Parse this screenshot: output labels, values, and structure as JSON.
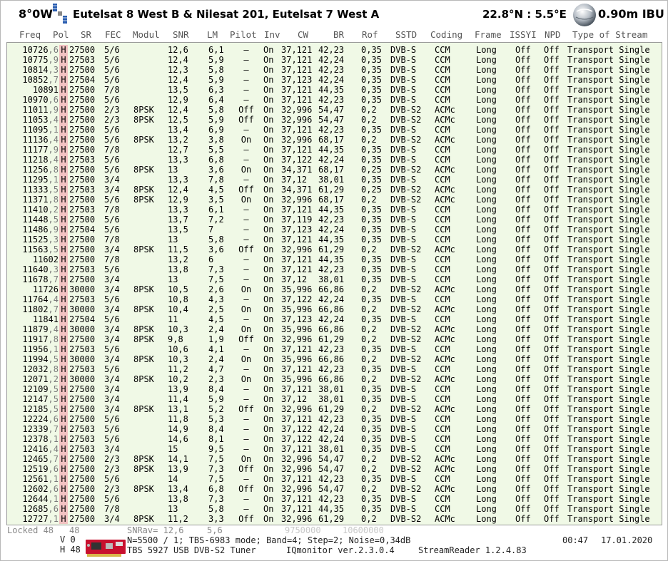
{
  "header": {
    "position": "8°0W",
    "title": "Eutelsat 8 West B & Nilesat 201, Eutelsat 7 West A",
    "coords": "22.8°N : 5.5°E",
    "dish": "0.90m IBU"
  },
  "columns": [
    "Freq",
    "Pol",
    "SR",
    "FEC",
    "Modul",
    "SNR",
    "LM",
    "Pilot",
    "Inv",
    "CW",
    "BR",
    "Rof",
    "SSTD",
    "Coding",
    "Frame",
    "ISSYI",
    "NPD",
    "Type of Stream"
  ],
  "rows": [
    [
      "10726,6",
      "H",
      "27500",
      "5/6",
      "",
      "12,6",
      "6,1",
      "–",
      "On",
      "37,121",
      "42,23",
      "0,35",
      "DVB-S",
      "CCM",
      "Long",
      "Off",
      "Off",
      "Transport Single"
    ],
    [
      "10775,9",
      "H",
      "27503",
      "5/6",
      "",
      "12,4",
      "5,9",
      "–",
      "On",
      "37,121",
      "42,24",
      "0,35",
      "DVB-S",
      "CCM",
      "Long",
      "Off",
      "Off",
      "Transport Single"
    ],
    [
      "10814,3",
      "H",
      "27500",
      "5/6",
      "",
      "12,3",
      "5,8",
      "–",
      "On",
      "37,121",
      "42,23",
      "0,35",
      "DVB-S",
      "CCM",
      "Long",
      "Off",
      "Off",
      "Transport Single"
    ],
    [
      "10852,7",
      "H",
      "27504",
      "5/6",
      "",
      "12,4",
      "5,9",
      "–",
      "On",
      "37,123",
      "42,24",
      "0,35",
      "DVB-S",
      "CCM",
      "Long",
      "Off",
      "Off",
      "Transport Single"
    ],
    [
      "10891",
      "H",
      "27500",
      "7/8",
      "",
      "13,5",
      "6,3",
      "–",
      "On",
      "37,121",
      "44,35",
      "0,35",
      "DVB-S",
      "CCM",
      "Long",
      "Off",
      "Off",
      "Transport Single"
    ],
    [
      "10970,6",
      "H",
      "27500",
      "5/6",
      "",
      "12,9",
      "6,4",
      "–",
      "On",
      "37,121",
      "42,23",
      "0,35",
      "DVB-S",
      "CCM",
      "Long",
      "Off",
      "Off",
      "Transport Single"
    ],
    [
      "11011,9",
      "H",
      "27500",
      "2/3",
      "8PSK",
      "12,4",
      "5,8",
      "Off",
      "On",
      "32,996",
      "54,47",
      "0,2",
      "DVB-S2",
      "ACMc",
      "Long",
      "Off",
      "Off",
      "Transport Single"
    ],
    [
      "11053,4",
      "H",
      "27500",
      "2/3",
      "8PSK",
      "12,5",
      "5,9",
      "Off",
      "On",
      "32,996",
      "54,47",
      "0,2",
      "DVB-S2",
      "ACMc",
      "Long",
      "Off",
      "Off",
      "Transport Single"
    ],
    [
      "11095,1",
      "H",
      "27500",
      "5/6",
      "",
      "13,4",
      "6,9",
      "–",
      "On",
      "37,121",
      "42,23",
      "0,35",
      "DVB-S",
      "CCM",
      "Long",
      "Off",
      "Off",
      "Transport Single"
    ],
    [
      "11136,4",
      "H",
      "27500",
      "5/6",
      "8PSK",
      "13,2",
      "3,8",
      "On",
      "On",
      "32,996",
      "68,17",
      "0,2",
      "DVB-S2",
      "ACMc",
      "Long",
      "Off",
      "Off",
      "Transport Single"
    ],
    [
      "11177,9",
      "H",
      "27500",
      "7/8",
      "",
      "12,7",
      "5,5",
      "–",
      "On",
      "37,121",
      "44,35",
      "0,35",
      "DVB-S",
      "CCM",
      "Long",
      "Off",
      "Off",
      "Transport Single"
    ],
    [
      "11218,4",
      "H",
      "27503",
      "5/6",
      "",
      "13,3",
      "6,8",
      "–",
      "On",
      "37,122",
      "42,24",
      "0,35",
      "DVB-S",
      "CCM",
      "Long",
      "Off",
      "Off",
      "Transport Single"
    ],
    [
      "11256,8",
      "H",
      "27500",
      "5/6",
      "8PSK",
      "13",
      "3,6",
      "On",
      "On",
      "34,371",
      "68,17",
      "0,25",
      "DVB-S2",
      "ACMc",
      "Long",
      "Off",
      "Off",
      "Transport Single"
    ],
    [
      "11295,1",
      "H",
      "27500",
      "3/4",
      "",
      "13,3",
      "7,8",
      "–",
      "On",
      "37,12",
      "38,01",
      "0,35",
      "DVB-S",
      "CCM",
      "Long",
      "Off",
      "Off",
      "Transport Single"
    ],
    [
      "11333,5",
      "H",
      "27503",
      "3/4",
      "8PSK",
      "12,4",
      "4,5",
      "Off",
      "On",
      "34,371",
      "61,29",
      "0,25",
      "DVB-S2",
      "ACMc",
      "Long",
      "Off",
      "Off",
      "Transport Single"
    ],
    [
      "11371,8",
      "H",
      "27500",
      "5/6",
      "8PSK",
      "12,9",
      "3,5",
      "On",
      "On",
      "32,996",
      "68,17",
      "0,2",
      "DVB-S2",
      "ACMc",
      "Long",
      "Off",
      "Off",
      "Transport Single"
    ],
    [
      "11410,2",
      "H",
      "27503",
      "7/8",
      "",
      "13,3",
      "6,1",
      "–",
      "On",
      "37,121",
      "44,35",
      "0,35",
      "DVB-S",
      "CCM",
      "Long",
      "Off",
      "Off",
      "Transport Single"
    ],
    [
      "11448,5",
      "H",
      "27500",
      "5/6",
      "",
      "13,7",
      "7,2",
      "–",
      "On",
      "37,119",
      "42,23",
      "0,35",
      "DVB-S",
      "CCM",
      "Long",
      "Off",
      "Off",
      "Transport Single"
    ],
    [
      "11486,9",
      "H",
      "27504",
      "5/6",
      "",
      "13,5",
      "7",
      "–",
      "On",
      "37,123",
      "42,24",
      "0,35",
      "DVB-S",
      "CCM",
      "Long",
      "Off",
      "Off",
      "Transport Single"
    ],
    [
      "11525,3",
      "H",
      "27500",
      "7/8",
      "",
      "13",
      "5,8",
      "–",
      "On",
      "37,121",
      "44,35",
      "0,35",
      "DVB-S",
      "CCM",
      "Long",
      "Off",
      "Off",
      "Transport Single"
    ],
    [
      "11563,5",
      "H",
      "27500",
      "3/4",
      "8PSK",
      "11,5",
      "3,6",
      "Off",
      "On",
      "32,996",
      "61,29",
      "0,2",
      "DVB-S2",
      "ACMc",
      "Long",
      "Off",
      "Off",
      "Transport Single"
    ],
    [
      "11602",
      "H",
      "27500",
      "7/8",
      "",
      "13,2",
      "6",
      "–",
      "On",
      "37,121",
      "44,35",
      "0,35",
      "DVB-S",
      "CCM",
      "Long",
      "Off",
      "Off",
      "Transport Single"
    ],
    [
      "11640,3",
      "H",
      "27503",
      "5/6",
      "",
      "13,8",
      "7,3",
      "–",
      "On",
      "37,121",
      "42,23",
      "0,35",
      "DVB-S",
      "CCM",
      "Long",
      "Off",
      "Off",
      "Transport Single"
    ],
    [
      "11678,7",
      "H",
      "27500",
      "3/4",
      "",
      "13",
      "7,5",
      "–",
      "On",
      "37,12",
      "38,01",
      "0,35",
      "DVB-S",
      "CCM",
      "Long",
      "Off",
      "Off",
      "Transport Single"
    ],
    [
      "11726",
      "H",
      "30000",
      "3/4",
      "8PSK",
      "10,5",
      "2,6",
      "On",
      "On",
      "35,996",
      "66,86",
      "0,2",
      "DVB-S2",
      "ACMc",
      "Long",
      "Off",
      "Off",
      "Transport Single"
    ],
    [
      "11764,4",
      "H",
      "27503",
      "5/6",
      "",
      "10,8",
      "4,3",
      "–",
      "On",
      "37,122",
      "42,24",
      "0,35",
      "DVB-S",
      "CCM",
      "Long",
      "Off",
      "Off",
      "Transport Single"
    ],
    [
      "11802,7",
      "H",
      "30000",
      "3/4",
      "8PSK",
      "10,4",
      "2,5",
      "On",
      "On",
      "35,996",
      "66,86",
      "0,2",
      "DVB-S2",
      "ACMc",
      "Long",
      "Off",
      "Off",
      "Transport Single"
    ],
    [
      "11841",
      "H",
      "27504",
      "5/6",
      "",
      "11",
      "4,5",
      "–",
      "On",
      "37,123",
      "42,24",
      "0,35",
      "DVB-S",
      "CCM",
      "Long",
      "Off",
      "Off",
      "Transport Single"
    ],
    [
      "11879,4",
      "H",
      "30000",
      "3/4",
      "8PSK",
      "10,3",
      "2,4",
      "On",
      "On",
      "35,996",
      "66,86",
      "0,2",
      "DVB-S2",
      "ACMc",
      "Long",
      "Off",
      "Off",
      "Transport Single"
    ],
    [
      "11917,8",
      "H",
      "27500",
      "3/4",
      "8PSK",
      "9,8",
      "1,9",
      "Off",
      "On",
      "32,996",
      "61,29",
      "0,2",
      "DVB-S2",
      "ACMc",
      "Long",
      "Off",
      "Off",
      "Transport Single"
    ],
    [
      "11956,1",
      "H",
      "27503",
      "5/6",
      "",
      "10,6",
      "4,1",
      "–",
      "On",
      "37,121",
      "42,23",
      "0,35",
      "DVB-S",
      "CCM",
      "Long",
      "Off",
      "Off",
      "Transport Single"
    ],
    [
      "11994,5",
      "H",
      "30000",
      "3/4",
      "8PSK",
      "10,3",
      "2,4",
      "On",
      "On",
      "35,996",
      "66,86",
      "0,2",
      "DVB-S2",
      "ACMc",
      "Long",
      "Off",
      "Off",
      "Transport Single"
    ],
    [
      "12032,8",
      "H",
      "27503",
      "5/6",
      "",
      "11,2",
      "4,7",
      "–",
      "On",
      "37,121",
      "42,23",
      "0,35",
      "DVB-S",
      "CCM",
      "Long",
      "Off",
      "Off",
      "Transport Single"
    ],
    [
      "12071,2",
      "H",
      "30000",
      "3/4",
      "8PSK",
      "10,2",
      "2,3",
      "On",
      "On",
      "35,996",
      "66,86",
      "0,2",
      "DVB-S2",
      "ACMc",
      "Long",
      "Off",
      "Off",
      "Transport Single"
    ],
    [
      "12109,5",
      "H",
      "27500",
      "3/4",
      "",
      "13,9",
      "8,4",
      "–",
      "On",
      "37,121",
      "38,01",
      "0,35",
      "DVB-S",
      "CCM",
      "Long",
      "Off",
      "Off",
      "Transport Single"
    ],
    [
      "12147,5",
      "H",
      "27500",
      "3/4",
      "",
      "11,4",
      "5,9",
      "–",
      "On",
      "37,12",
      "38,01",
      "0,35",
      "DVB-S",
      "CCM",
      "Long",
      "Off",
      "Off",
      "Transport Single"
    ],
    [
      "12185,5",
      "H",
      "27500",
      "3/4",
      "8PSK",
      "13,1",
      "5,2",
      "Off",
      "On",
      "32,996",
      "61,29",
      "0,2",
      "DVB-S2",
      "ACMc",
      "Long",
      "Off",
      "Off",
      "Transport Single"
    ],
    [
      "12224,6",
      "H",
      "27500",
      "5/6",
      "",
      "11,8",
      "5,3",
      "–",
      "On",
      "37,121",
      "42,23",
      "0,35",
      "DVB-S",
      "CCM",
      "Long",
      "Off",
      "Off",
      "Transport Single"
    ],
    [
      "12339,7",
      "H",
      "27503",
      "5/6",
      "",
      "14,9",
      "8,4",
      "–",
      "On",
      "37,122",
      "42,24",
      "0,35",
      "DVB-S",
      "CCM",
      "Long",
      "Off",
      "Off",
      "Transport Single"
    ],
    [
      "12378,1",
      "H",
      "27503",
      "5/6",
      "",
      "14,6",
      "8,1",
      "–",
      "On",
      "37,122",
      "42,24",
      "0,35",
      "DVB-S",
      "CCM",
      "Long",
      "Off",
      "Off",
      "Transport Single"
    ],
    [
      "12416,4",
      "H",
      "27503",
      "3/4",
      "",
      "15",
      "9,5",
      "–",
      "On",
      "37,121",
      "38,01",
      "0,35",
      "DVB-S",
      "CCM",
      "Long",
      "Off",
      "Off",
      "Transport Single"
    ],
    [
      "12465,7",
      "H",
      "27500",
      "2/3",
      "8PSK",
      "14,1",
      "7,5",
      "On",
      "On",
      "32,996",
      "54,47",
      "0,2",
      "DVB-S2",
      "ACMc",
      "Long",
      "Off",
      "Off",
      "Transport Single"
    ],
    [
      "12519,6",
      "H",
      "27500",
      "2/3",
      "8PSK",
      "13,9",
      "7,3",
      "Off",
      "On",
      "32,996",
      "54,47",
      "0,2",
      "DVB-S2",
      "ACMc",
      "Long",
      "Off",
      "Off",
      "Transport Single"
    ],
    [
      "12561,1",
      "H",
      "27500",
      "5/6",
      "",
      "14",
      "7,5",
      "–",
      "On",
      "37,121",
      "42,23",
      "0,35",
      "DVB-S",
      "CCM",
      "Long",
      "Off",
      "Off",
      "Transport Single"
    ],
    [
      "12602,6",
      "H",
      "27500",
      "2/3",
      "8PSK",
      "13,4",
      "6,8",
      "Off",
      "On",
      "32,996",
      "54,47",
      "0,2",
      "DVB-S2",
      "ACMc",
      "Long",
      "Off",
      "Off",
      "Transport Single"
    ],
    [
      "12644,1",
      "H",
      "27500",
      "5/6",
      "",
      "13,8",
      "7,3",
      "–",
      "On",
      "37,121",
      "42,23",
      "0,35",
      "DVB-S",
      "CCM",
      "Long",
      "Off",
      "Off",
      "Transport Single"
    ],
    [
      "12685,6",
      "H",
      "27500",
      "7/8",
      "",
      "13",
      "5,8",
      "–",
      "On",
      "37,121",
      "44,35",
      "0,35",
      "DVB-S",
      "CCM",
      "Long",
      "Off",
      "Off",
      "Transport Single"
    ],
    [
      "12727,1",
      "H",
      "27500",
      "3/4",
      "8PSK",
      "11,2",
      "3,3",
      "Off",
      "On",
      "32,996",
      "61,29",
      "0,2",
      "DVB-S2",
      "ACMc",
      "Long",
      "Off",
      "Off",
      "Transport Single"
    ]
  ],
  "footer": {
    "locked": "Locked 48",
    "locked_count": "48",
    "v_label": "V 0",
    "h_label": "H 48",
    "snrav_label": "SNRav= 12,6",
    "snrav_lm": "5,6",
    "lof1": "9750000",
    "lof2": "10600000",
    "mode_line": "N=5500 / 1; TBS-6983 mode; Band=4; Step=2; Noise=0,34dB",
    "tuner_line": "TBS 5927 USB DVB-S2 Tuner",
    "iqmonitor": "IQmonitor ver.2.3.0.4",
    "streamreader": "StreamReader 1.2.4.83",
    "time": "00:47",
    "date": "17.01.2020"
  },
  "colors": {
    "table_bg": "#f0f9e6",
    "pol_bg": "#f2c2c2"
  },
  "icons": [
    "satellite-icon",
    "globe-dish-icon",
    "tuner-card-icon"
  ]
}
